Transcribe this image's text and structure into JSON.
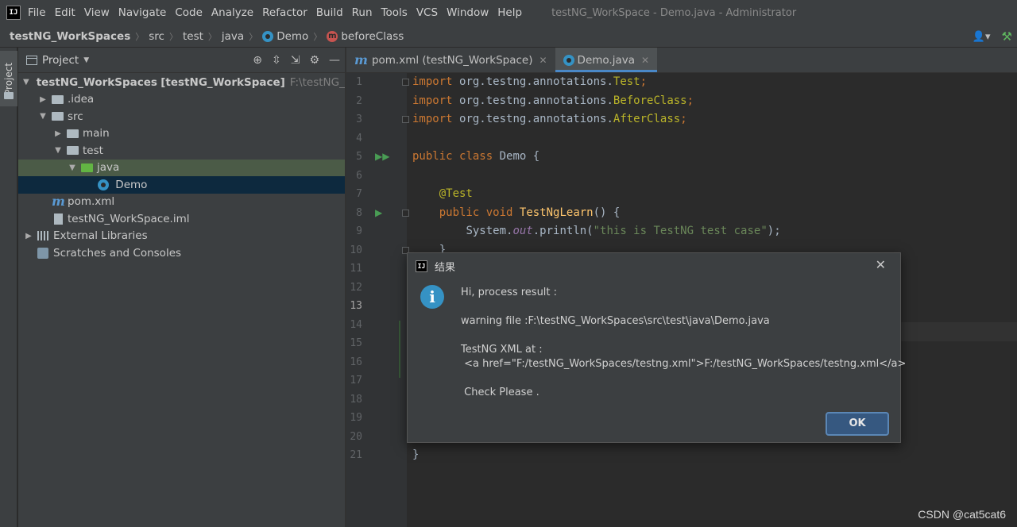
{
  "app": {
    "logo": "IJ",
    "menu": [
      "File",
      "Edit",
      "View",
      "Navigate",
      "Code",
      "Analyze",
      "Refactor",
      "Build",
      "Run",
      "Tools",
      "VCS",
      "Window",
      "Help"
    ],
    "window_title": "testNG_WorkSpace - Demo.java - Administrator"
  },
  "breadcrumb": {
    "project": "testNG_WorkSpaces",
    "src": "src",
    "test": "test",
    "java": "java",
    "cls": "Demo",
    "method": "beforeClass",
    "method_badge": "m"
  },
  "sidebar": {
    "tab_label": "Project"
  },
  "project_panel": {
    "title": "Project",
    "tree": {
      "root_name": "testNG_WorkSpaces",
      "root_module": "[testNG_WorkSpace]",
      "root_path": "F:\\testNG_WorkSpaces",
      "idea": ".idea",
      "src": "src",
      "main": "main",
      "test": "test",
      "java": "java",
      "demo": "Demo",
      "pom": "pom.xml",
      "iml": "testNG_WorkSpace.iml",
      "libs": "External Libraries",
      "scratches": "Scratches and Consoles"
    }
  },
  "editor": {
    "tabs": [
      {
        "label": "pom.xml (testNG_WorkSpace)"
      },
      {
        "label": "Demo.java"
      }
    ],
    "lines": [
      "1",
      "2",
      "3",
      "4",
      "5",
      "6",
      "7",
      "8",
      "9",
      "10",
      "11",
      "12",
      "13",
      "14",
      "15",
      "16",
      "17",
      "18",
      "19",
      "20",
      "21"
    ],
    "code": {
      "imp": "import",
      "pkg": "org.testng.annotations.",
      "test": "Test",
      "before": "BeforeClass",
      "after": "AfterClass",
      "semi": ";",
      "pub": "public",
      "clsk": "class",
      "clsname": " Demo {",
      "annot": "@Test",
      "void": "void",
      "method": "TestNgLearn",
      "paren": "() {",
      "sys": "System.",
      "out": "out",
      "println": ".println(",
      "str": "\"this is TestNG test case\"",
      "end": ");",
      "brace": "}"
    }
  },
  "dialog": {
    "logo": "IJ",
    "title": "结果",
    "message": "Hi, process result :\n\nwarning file :F:\\testNG_WorkSpaces\\src\\test\\java\\Demo.java\n\nTestNG XML at :\n <a href=\"F:/testNG_WorkSpaces/testng.xml\">F:/testNG_WorkSpaces/testng.xml</a>\n\n Check Please .",
    "ok": "OK"
  },
  "watermark": "CSDN @cat5cat6"
}
